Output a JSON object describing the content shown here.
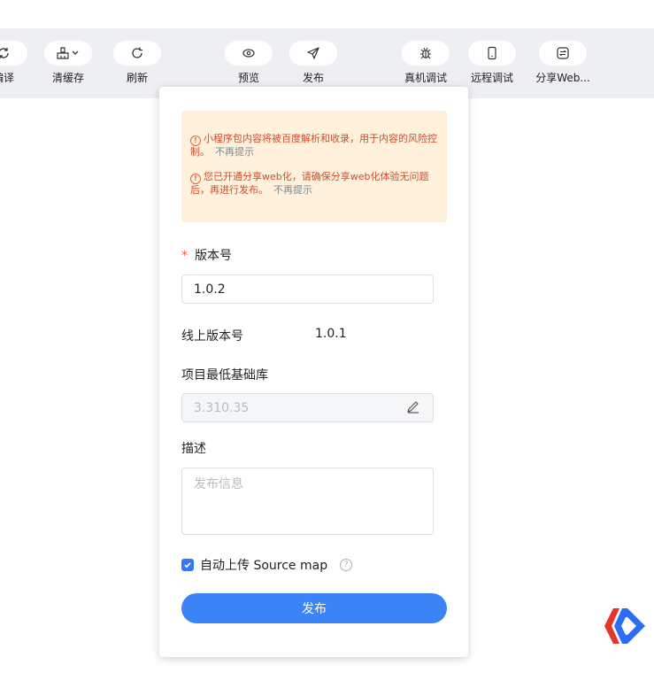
{
  "toolbar": {
    "items": [
      {
        "label": "编译",
        "icon": "compile-icon"
      },
      {
        "label": "清缓存",
        "icon": "broom-icon"
      },
      {
        "label": "刷新",
        "icon": "refresh-icon"
      },
      {
        "label": "预览",
        "icon": "eye-icon"
      },
      {
        "label": "发布",
        "icon": "send-icon"
      },
      {
        "label": "真机调试",
        "icon": "bug-icon"
      },
      {
        "label": "远程调试",
        "icon": "phone-icon"
      },
      {
        "label": "分享Web...",
        "icon": "share-web-icon"
      }
    ]
  },
  "panel": {
    "notices": [
      {
        "text": "小程序包内容将被百度解析和收录，用于内容的风险控制。",
        "dismiss": "不再提示"
      },
      {
        "text": "您已开通分享web化，请确保分享web化体验无问题后，再进行发布。",
        "dismiss": "不再提示"
      }
    ],
    "version_label": "版本号",
    "required_mark": "*",
    "version_value": "1.0.2",
    "online_label": "线上版本号",
    "online_value": "1.0.1",
    "baselib_label": "项目最低基础库",
    "baselib_value": "3.310.35",
    "desc_label": "描述",
    "desc_placeholder": "发布信息",
    "sourcemap_label": "自动上传 Source map",
    "sourcemap_checked": true,
    "help_glyph": "?",
    "publish_button": "发布"
  },
  "colors": {
    "accent": "#3a84f7",
    "warning_text": "#d14c2c",
    "warning_bg": "#fff1dc",
    "brand_red": "#e4342c",
    "brand_blue": "#2f6cf5"
  }
}
